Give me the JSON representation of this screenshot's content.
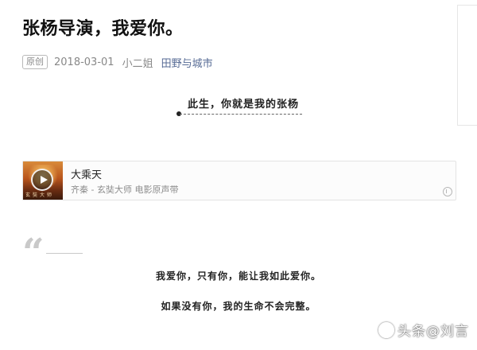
{
  "article": {
    "title": "张杨导演，我爱你。",
    "badge": "原创",
    "date": "2018-03-01",
    "author": "小二姐",
    "account": "田野与城市"
  },
  "subtitle": "此生，你就是我的张杨",
  "music": {
    "title": "大乘天",
    "subtitle": "齐秦 - 玄奘大师 电影原声带",
    "cover_caption": "玄奘大师"
  },
  "quote": {
    "mark": "“",
    "lines": [
      "我爱你，只有你，能让我如此爱你。",
      "如果没有你，我的生命不会完整。"
    ]
  },
  "watermark": {
    "text": "头条@刘言"
  }
}
